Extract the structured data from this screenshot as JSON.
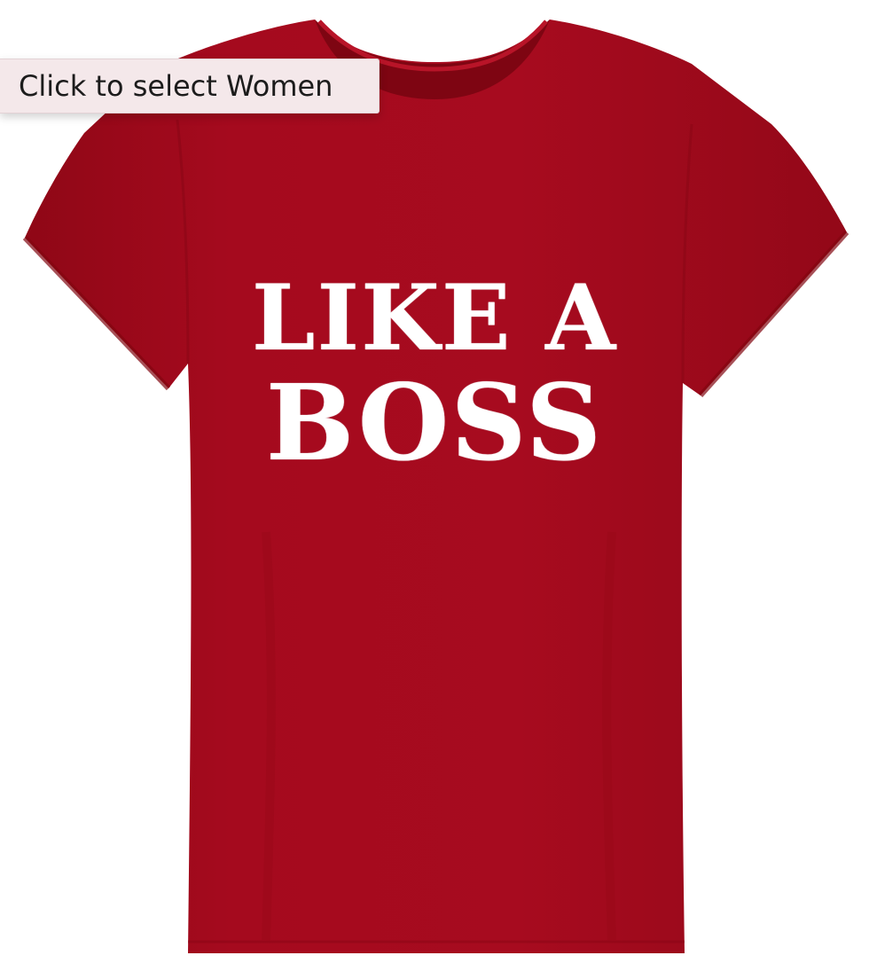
{
  "tooltip": {
    "label": "Click to select Women"
  },
  "product": {
    "shirt_color": "#a50a1e",
    "print_color": "#ffffff",
    "print_line_1": "LIKE A",
    "print_line_2": "BOSS"
  }
}
